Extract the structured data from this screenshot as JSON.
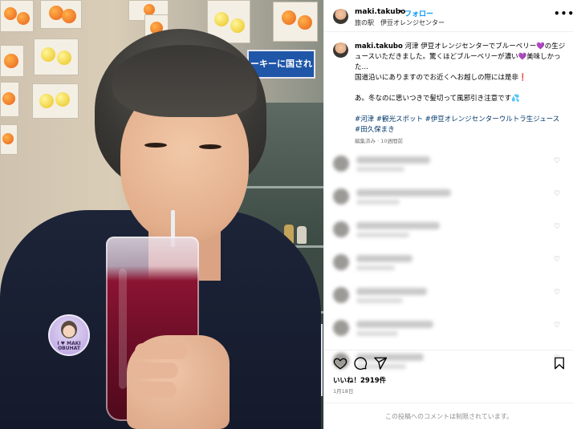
{
  "post": {
    "username": "maki.takubo",
    "follow_label": "フォロー",
    "separator": "•",
    "location": "旅の駅　伊豆オレンジセンター",
    "more_icon": "more-horizontal-icon"
  },
  "caption": {
    "username": "maki.takubo",
    "body": " 河津 伊豆オレンジセンターでブルーベリー💜の生ジュースいただきました。驚くほどブルーベリーが濃い💜美味しかった…\n国道沿いにありますのでお近くへお越しの際には是非❗\n\nあ。冬なのに思いつきで髪切って風邪引き注意です💦",
    "hashtags": "#河津 #観光スポット #伊豆オレンジセンターウルトラ生ジュース\n#田久保まき",
    "meta": "編集済み · 10週間前"
  },
  "photo": {
    "sign_text": "ーキーに国され",
    "badge_text": "I ♥ MAKI\nOBUHAT"
  },
  "comments_count": 7,
  "actions": {
    "like_icon": "heart-icon",
    "comment_icon": "comment-icon",
    "share_icon": "send-icon",
    "save_icon": "bookmark-icon"
  },
  "likes": "いいね！2919件",
  "date": "1月18日",
  "comments_closed": "この投稿へのコメントは制限されています。",
  "colors": {
    "follow_blue": "#0095f6",
    "hashtag_blue": "#00376b",
    "muted_gray": "#737373"
  }
}
